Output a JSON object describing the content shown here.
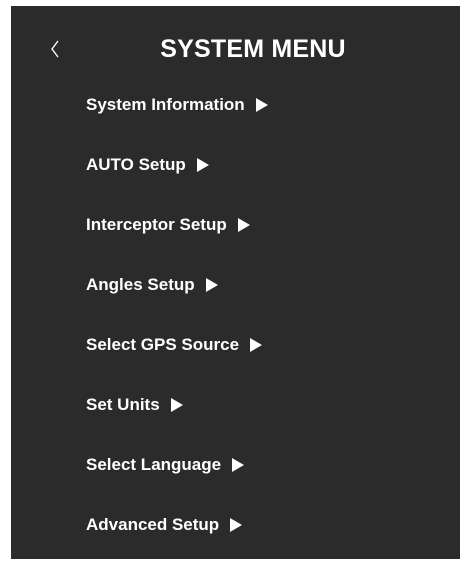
{
  "header": {
    "title": "SYSTEM MENU",
    "back_icon": "chevron-left-icon"
  },
  "menu": {
    "items": [
      {
        "label": "System Information",
        "icon": "play-arrow-icon"
      },
      {
        "label": "AUTO Setup",
        "icon": "play-arrow-icon"
      },
      {
        "label": "Interceptor Setup",
        "icon": "play-arrow-icon"
      },
      {
        "label": "Angles Setup",
        "icon": "play-arrow-icon"
      },
      {
        "label": "Select GPS Source",
        "icon": "play-arrow-icon"
      },
      {
        "label": "Set Units",
        "icon": "play-arrow-icon"
      },
      {
        "label": "Select Language",
        "icon": "play-arrow-icon"
      },
      {
        "label": "Advanced Setup",
        "icon": "play-arrow-icon"
      }
    ]
  },
  "colors": {
    "background": "#2b2b2b",
    "text": "#ffffff",
    "page": "#ffffff"
  }
}
